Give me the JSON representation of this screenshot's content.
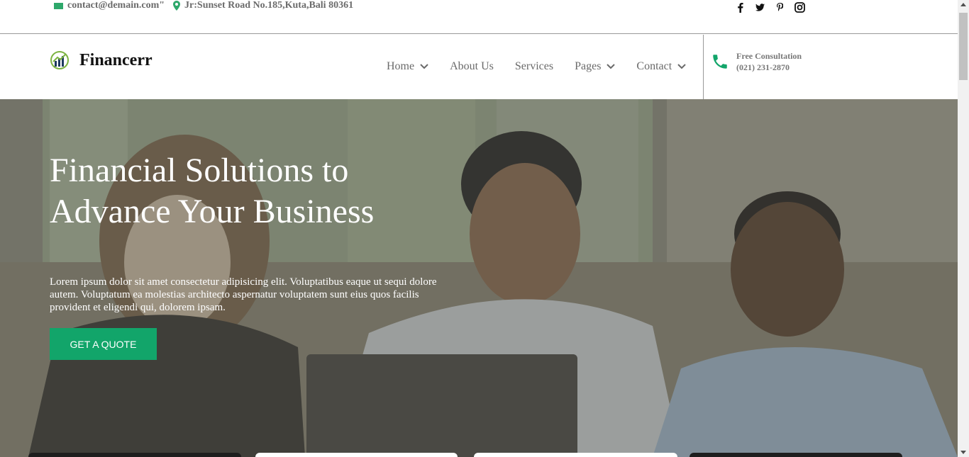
{
  "topbar": {
    "email": "contact@demain.com\"",
    "address": "Jr:Sunset Road No.185,Kuta,Bali 80361",
    "social": [
      "facebook-icon",
      "twitter-icon",
      "pinterest-icon",
      "instagram-icon"
    ]
  },
  "nav": {
    "brand": "Financerr",
    "items": [
      {
        "label": "Home",
        "dropdown": true
      },
      {
        "label": "About Us",
        "dropdown": false
      },
      {
        "label": "Services",
        "dropdown": false
      },
      {
        "label": "Pages",
        "dropdown": true
      },
      {
        "label": "Contact",
        "dropdown": true
      }
    ],
    "consult_title": "Free Consultation",
    "consult_phone": "(021) 231-2870"
  },
  "hero": {
    "title": "Financial Solutions to Advance Your Business",
    "text": "Lorem ipsum dolor sit amet consectetur adipisicing elit. Voluptatibus eaque ut sequi dolore autem. Voluptatum ea molestias architecto aspernatur voluptatem sunt eius quos facilis provident et eligendi qui, dolorem ipsam.",
    "cta": "GET A QUOTE"
  },
  "colors": {
    "accent": "#12a56a",
    "text_gray": "#6a6a6a"
  }
}
